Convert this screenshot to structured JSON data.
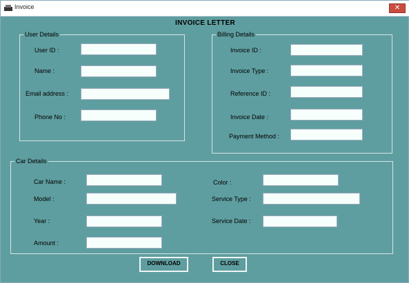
{
  "window": {
    "title": "Invoice",
    "close_glyph": "✕"
  },
  "heading": "INVOICE LETTER",
  "user_details": {
    "legend": "User Details",
    "fields": [
      {
        "label": "User ID :",
        "value": ""
      },
      {
        "label": "Name :",
        "value": ""
      },
      {
        "label": "Email address :",
        "value": ""
      },
      {
        "label": "Phone No :",
        "value": ""
      }
    ]
  },
  "billing_details": {
    "legend": "Billing Details",
    "fields": [
      {
        "label": "Invoice ID :",
        "value": ""
      },
      {
        "label": "Invoice Type :",
        "value": ""
      },
      {
        "label": "Reference ID :",
        "value": ""
      },
      {
        "label": "Invoice Date :",
        "value": ""
      },
      {
        "label": "Payment Method :",
        "value": ""
      }
    ]
  },
  "car_details": {
    "legend": "Car Details",
    "left": [
      {
        "label": "Car Name :",
        "value": ""
      },
      {
        "label": "Model :",
        "value": ""
      },
      {
        "label": "Year :",
        "value": ""
      },
      {
        "label": "Amount :",
        "value": ""
      }
    ],
    "right": [
      {
        "label": "Color :",
        "value": ""
      },
      {
        "label": "Service Type :",
        "value": ""
      },
      {
        "label": "Service Date :",
        "value": ""
      }
    ]
  },
  "buttons": {
    "download": "DOWNLOAD",
    "close": "CLOSE"
  },
  "colors": {
    "background": "#5f9ea0",
    "input_bg": "#f7fffd",
    "close_button": "#c94c3f"
  },
  "icons": {
    "app": "printer-icon",
    "close": "close-icon"
  }
}
